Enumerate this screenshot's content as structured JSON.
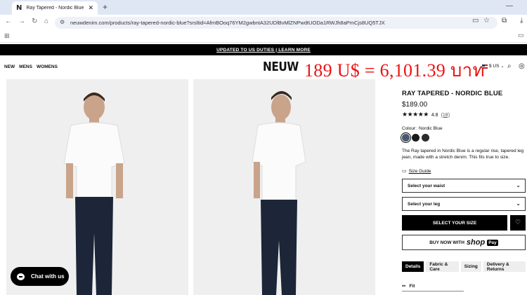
{
  "browser": {
    "tab_title": "Ray Tapered - Nordic Blue | Ne",
    "favicon": "N",
    "url": "neuwdenim.com/products/ray-tapered-nordic-blue?srsltid=AfmBOoq76YM2gwbntA32UDlBvMlZNPwdtUODa1RWJh8aPmCjs8UQ5TJX"
  },
  "promo": {
    "text": "UPDATED TO US DUTIES | LEARN MORE"
  },
  "header": {
    "nav": [
      "NEW",
      "MENS",
      "WOMENS"
    ],
    "logo": "NEUW",
    "overlay": "189 U$ = 6,101.39 บาท",
    "currency": "$ US"
  },
  "product": {
    "title": "RAY TAPERED - NORDIC BLUE",
    "price": "$189.00",
    "stars": "★★★★★",
    "rating": "4.8",
    "review_count": "(18)",
    "colour_label": "Colour:",
    "colour_value": "Nordic Blue",
    "swatch_colors": [
      "#4a5a6e",
      "#1a1a1a",
      "#2c2c2c"
    ],
    "description": "The Ray tapered in Nordic Blue is a regular rise, tapered leg jean, made with a stretch denim. This fits true to size.",
    "size_guide": "Size Guide",
    "select_waist": "Select your waist",
    "select_leg": "Select your leg",
    "select_size_button": "SELECT YOUR SIZE",
    "buy_now_label": "BUY NOW WITH",
    "shop_word": "shop",
    "pay_word": "Pay",
    "tabs": [
      "Details",
      "Fabric & Care",
      "Sizing",
      "Delivery & Returns"
    ],
    "fit_label": "Fit"
  },
  "chat": {
    "label": "Chat with us"
  }
}
